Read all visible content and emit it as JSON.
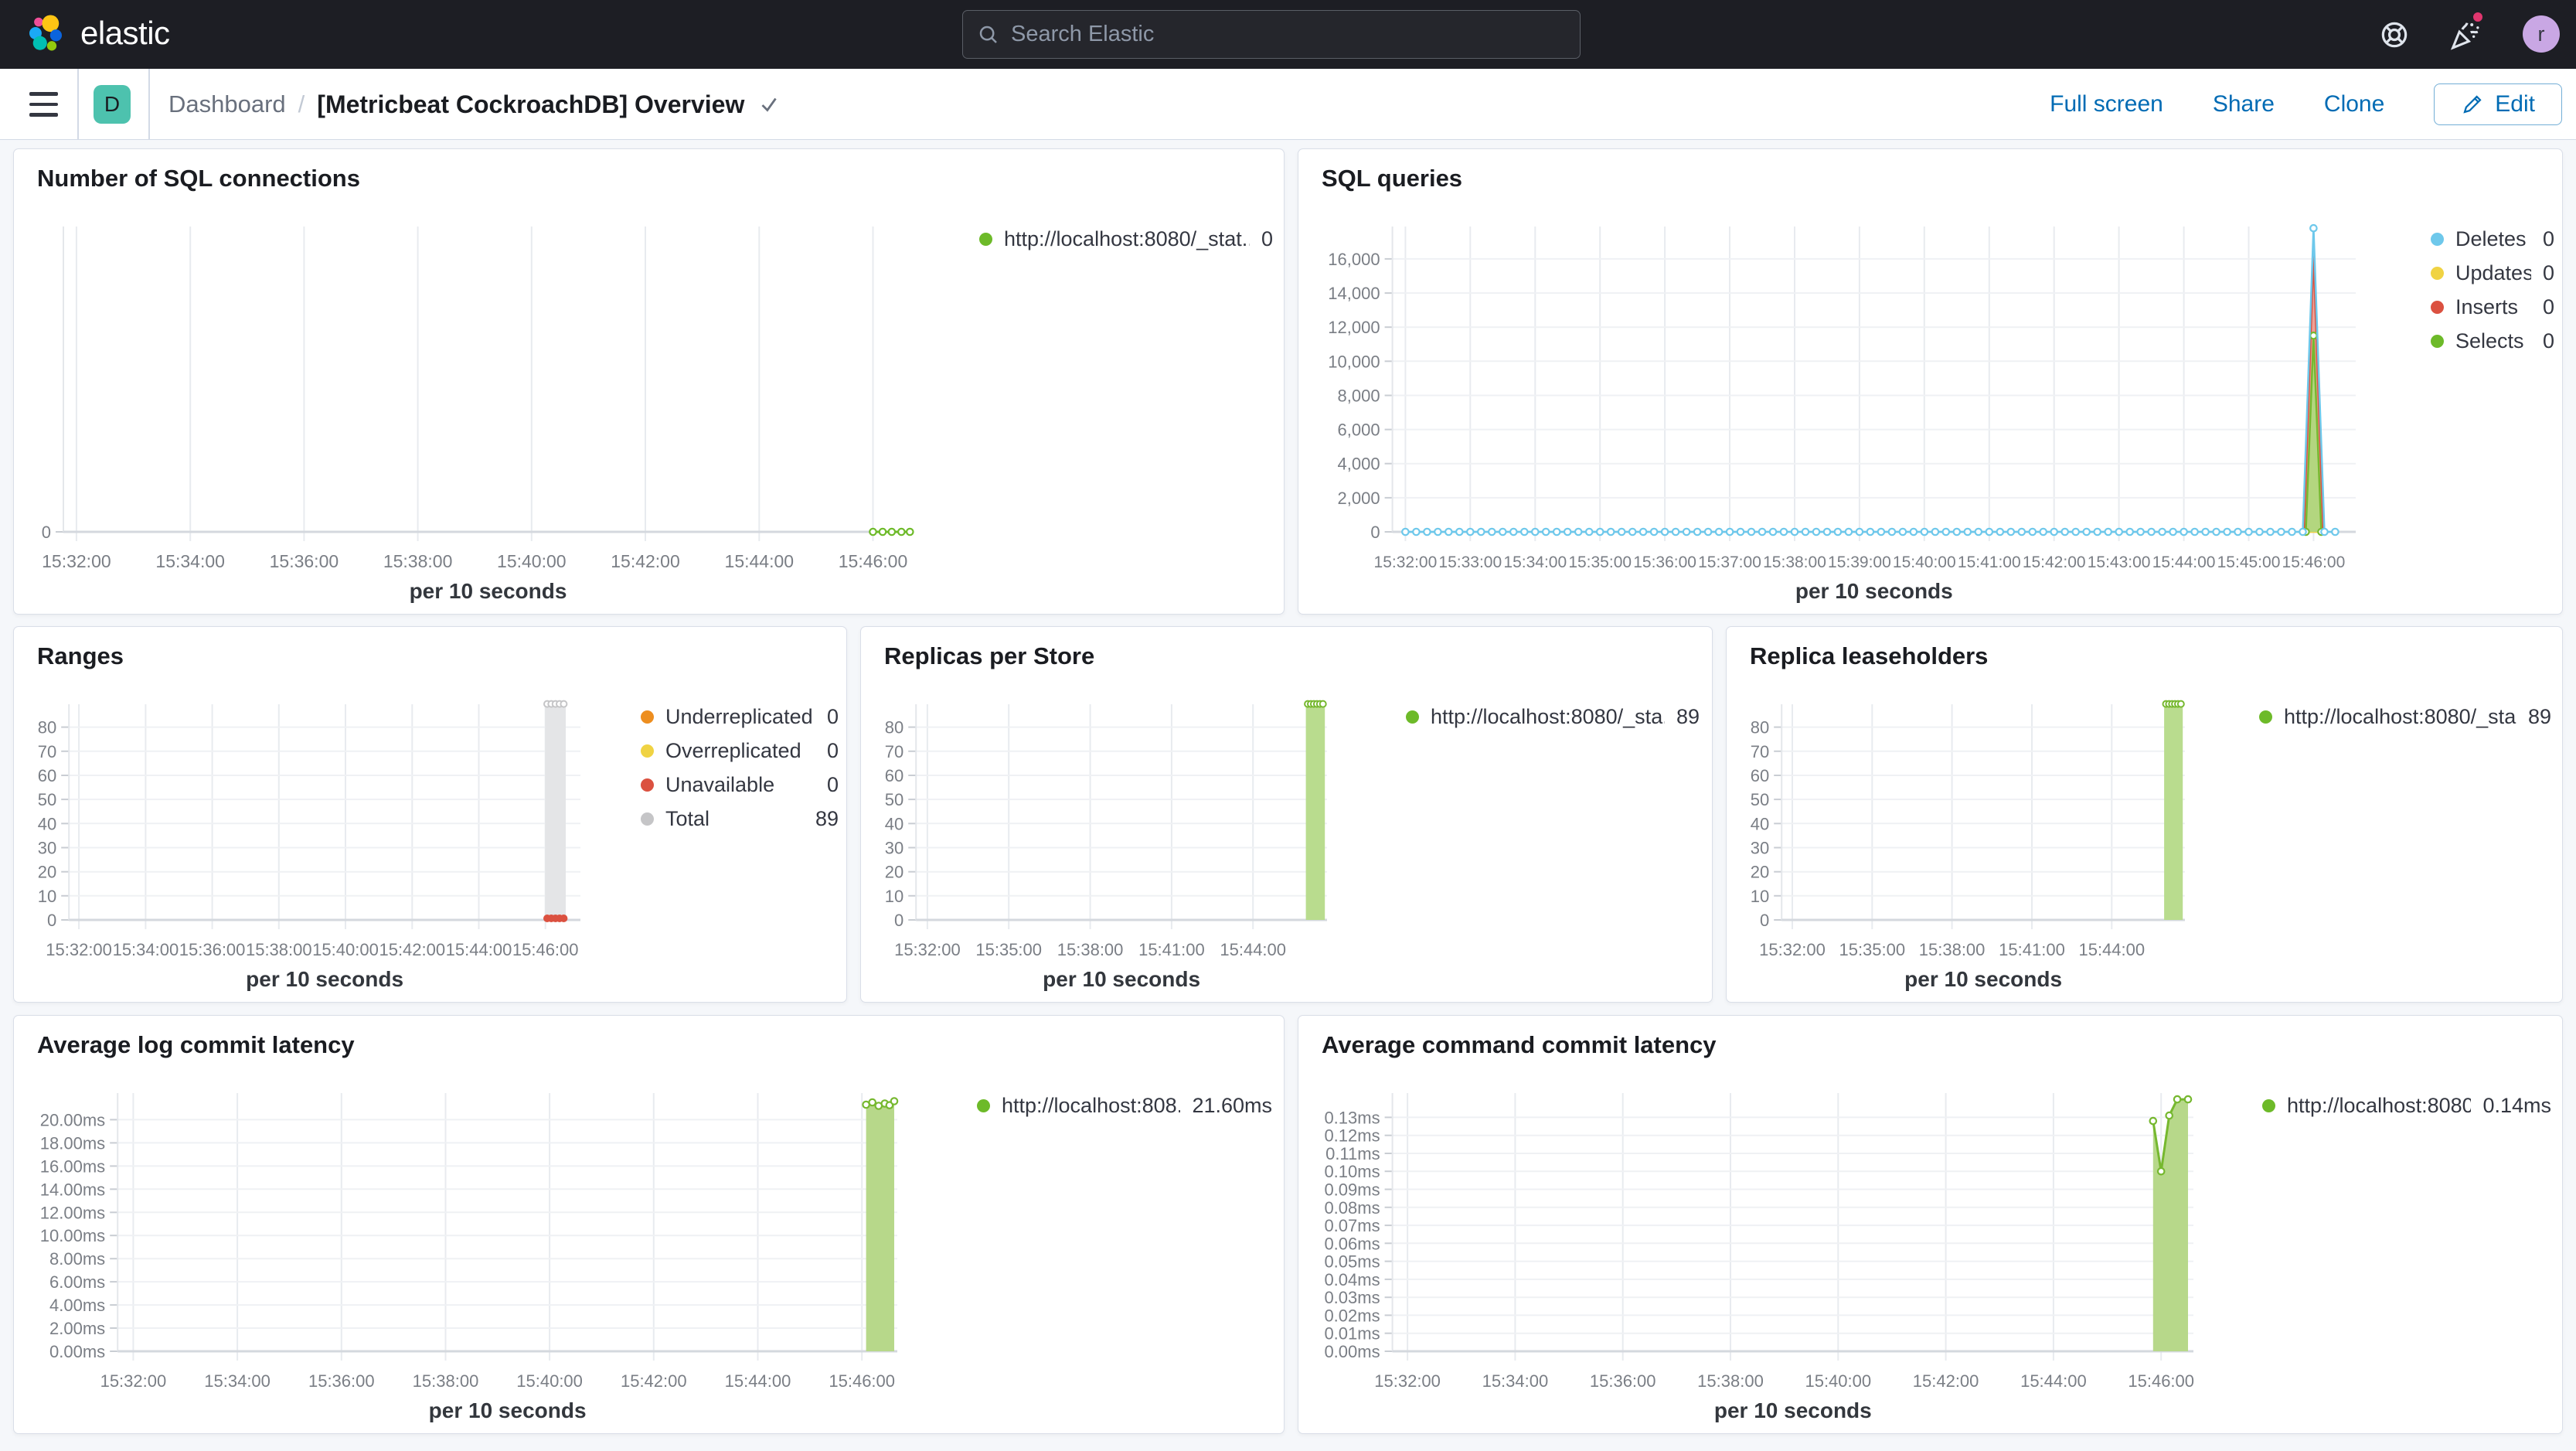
{
  "header": {
    "brand": "elastic",
    "search_placeholder": "Search Elastic",
    "avatar_initial": "r",
    "bg_color": "#1D1E24",
    "notification_dot_color": "#E0366E",
    "avatar_color": "#C9A7E4"
  },
  "nav": {
    "app_badge": "D",
    "app_badge_color": "#4DC2AE",
    "breadcrumb_section": "Dashboard",
    "breadcrumb_sep": "/",
    "title": "[Metricbeat CockroachDB] Overview",
    "full_screen": "Full screen",
    "share": "Share",
    "clone": "Clone",
    "edit": "Edit",
    "link_color": "#006BB4"
  },
  "panels": [
    {
      "title": "Number of SQL connections",
      "legend": {
        "items": [
          {
            "color": "#6DBA29",
            "label": "http://localhost:8080/_stat...",
            "value": "0"
          }
        ]
      },
      "chart": {
        "type": "line",
        "x_domain": [
          31.77,
          46.7
        ],
        "x_ticks": [
          {
            "label": "15:32:00",
            "t": 32
          },
          {
            "label": "15:34:00",
            "t": 34
          },
          {
            "label": "15:36:00",
            "t": 36
          },
          {
            "label": "15:38:00",
            "t": 38
          },
          {
            "label": "15:40:00",
            "t": 40
          },
          {
            "label": "15:42:00",
            "t": 42
          },
          {
            "label": "15:44:00",
            "t": 44
          },
          {
            "label": "15:46:00",
            "t": 46
          }
        ],
        "x_tick_font": 23,
        "y_domain_max": 10,
        "y_ticks": [
          {
            "label": "0",
            "v": 0
          }
        ],
        "axis_label": "per 10 seconds",
        "series": [
          {
            "name": "http://localhost:8080/_stat...",
            "type": "line",
            "color": "#6DBA29",
            "width": 3,
            "marker": true,
            "points": [
              [
                46.0,
                0
              ],
              [
                46.17,
                0
              ],
              [
                46.33,
                0
              ],
              [
                46.5,
                0
              ],
              [
                46.65,
                0
              ]
            ]
          }
        ]
      }
    },
    {
      "title": "SQL queries",
      "legend": {
        "items": [
          {
            "color": "#6EC8EB",
            "label": "Deletes",
            "value": "0"
          },
          {
            "color": "#F0D343",
            "label": "Updates",
            "value": "0"
          },
          {
            "color": "#DB5140",
            "label": "Inserts",
            "value": "0"
          },
          {
            "color": "#6DBA29",
            "label": "Selects",
            "value": "0"
          }
        ]
      },
      "chart": {
        "type": "line",
        "x_domain": [
          31.8,
          46.65
        ],
        "x_ticks": [
          {
            "label": "15:32:00",
            "t": 32
          },
          {
            "label": "15:33:00",
            "t": 33
          },
          {
            "label": "15:34:00",
            "t": 34
          },
          {
            "label": "15:35:00",
            "t": 35
          },
          {
            "label": "15:36:00",
            "t": 36
          },
          {
            "label": "15:37:00",
            "t": 37
          },
          {
            "label": "15:38:00",
            "t": 38
          },
          {
            "label": "15:39:00",
            "t": 39
          },
          {
            "label": "15:40:00",
            "t": 40
          },
          {
            "label": "15:41:00",
            "t": 41
          },
          {
            "label": "15:42:00",
            "t": 42
          },
          {
            "label": "15:43:00",
            "t": 43
          },
          {
            "label": "15:44:00",
            "t": 44
          },
          {
            "label": "15:45:00",
            "t": 45
          },
          {
            "label": "15:46:00",
            "t": 46
          }
        ],
        "x_tick_font": 21,
        "y_domain_max": 17900,
        "y_ticks": [
          {
            "label": "0",
            "v": 0
          },
          {
            "label": "2,000",
            "v": 2000
          },
          {
            "label": "4,000",
            "v": 4000
          },
          {
            "label": "6,000",
            "v": 6000
          },
          {
            "label": "8,000",
            "v": 8000
          },
          {
            "label": "10,000",
            "v": 10000
          },
          {
            "label": "12,000",
            "v": 12000
          },
          {
            "label": "14,000",
            "v": 14000
          },
          {
            "label": "16,000",
            "v": 16000
          }
        ],
        "axis_label": "per 10 seconds",
        "series": [
          {
            "name": "Updates",
            "type": "line",
            "color": "#F0D343",
            "width": 2.5,
            "marker": false,
            "points": [
              [
                45.83,
                0
              ],
              [
                46.17,
                0
              ]
            ]
          },
          {
            "name": "Inserts",
            "type": "area",
            "color": "#DB5140",
            "fill": "#EDA197",
            "width": 2.5,
            "marker": false,
            "points": [
              [
                45.85,
                0
              ],
              [
                46.0,
                16200
              ],
              [
                46.15,
                0
              ]
            ]
          },
          {
            "name": "Selects",
            "type": "area",
            "color": "#76B82F",
            "fill": "#B3D67F",
            "width": 2.5,
            "marker": true,
            "points": [
              [
                45.88,
                0
              ],
              [
                46.0,
                11500
              ],
              [
                46.12,
                0
              ]
            ]
          },
          {
            "name": "Deletes",
            "type": "line",
            "color": "#6EC8EB",
            "width": 2.5,
            "marker": true,
            "zero_range": [
              32.0,
              46.5,
              0.16667
            ],
            "points": [
              [
                46.0,
                17800
              ]
            ]
          }
        ]
      }
    },
    {
      "title": "Ranges",
      "legend": {
        "items": [
          {
            "color": "#ED8E1F",
            "label": "Underreplicated",
            "value": "0"
          },
          {
            "color": "#F0D343",
            "label": "Overreplicated",
            "value": "0"
          },
          {
            "color": "#DB5140",
            "label": "Unavailable",
            "value": "0"
          },
          {
            "color": "#C5C5C7",
            "label": "Total",
            "value": "89"
          }
        ]
      },
      "chart": {
        "type": "bar",
        "x_domain": [
          31.7,
          47.05
        ],
        "x_ticks": [
          {
            "label": "15:32:00",
            "t": 32
          },
          {
            "label": "15:34:00",
            "t": 34
          },
          {
            "label": "15:36:00",
            "t": 36
          },
          {
            "label": "15:38:00",
            "t": 38
          },
          {
            "label": "15:40:00",
            "t": 40
          },
          {
            "label": "15:42:00",
            "t": 42
          },
          {
            "label": "15:44:00",
            "t": 44
          },
          {
            "label": "15:46:00",
            "t": 46
          }
        ],
        "x_tick_font": 22,
        "y_domain_max": 89.5,
        "y_ticks": [
          {
            "label": "0",
            "v": 0
          },
          {
            "label": "10",
            "v": 10
          },
          {
            "label": "20",
            "v": 20
          },
          {
            "label": "30",
            "v": 30
          },
          {
            "label": "40",
            "v": 40
          },
          {
            "label": "50",
            "v": 50
          },
          {
            "label": "60",
            "v": 60
          },
          {
            "label": "70",
            "v": 70
          },
          {
            "label": "80",
            "v": 80
          }
        ],
        "axis_label": "per 10 seconds",
        "series": [
          {
            "name": "Total",
            "type": "bar",
            "t": 46.3,
            "halfwidth": 0.31,
            "value": 89,
            "fill": "#E4E5E7",
            "edge": "#C5C5C7",
            "top_markers": 5,
            "bottom_markers": {
              "color": "#DB5140",
              "count": 5
            }
          }
        ]
      }
    },
    {
      "title": "Replicas per Store",
      "legend": {
        "items": [
          {
            "color": "#6DBA29",
            "label": "http://localhost:8080/_sta...",
            "value": "89"
          }
        ]
      },
      "chart": {
        "type": "bar",
        "x_domain": [
          31.58,
          46.73
        ],
        "x_ticks": [
          {
            "label": "15:32:00",
            "t": 32
          },
          {
            "label": "15:35:00",
            "t": 35
          },
          {
            "label": "15:38:00",
            "t": 38
          },
          {
            "label": "15:41:00",
            "t": 41
          },
          {
            "label": "15:44:00",
            "t": 44
          }
        ],
        "x_tick_font": 22,
        "y_domain_max": 89.5,
        "y_ticks": [
          {
            "label": "0",
            "v": 0
          },
          {
            "label": "10",
            "v": 10
          },
          {
            "label": "20",
            "v": 20
          },
          {
            "label": "30",
            "v": 30
          },
          {
            "label": "40",
            "v": 40
          },
          {
            "label": "50",
            "v": 50
          },
          {
            "label": "60",
            "v": 60
          },
          {
            "label": "70",
            "v": 70
          },
          {
            "label": "80",
            "v": 80
          }
        ],
        "axis_label": "per 10 seconds",
        "series": [
          {
            "name": "http://localhost:8080/_sta...",
            "type": "bar",
            "t": 46.3,
            "halfwidth": 0.35,
            "value": 89,
            "fill": "#B9DC8E",
            "edge": "#76B82F",
            "top_markers": 6
          }
        ]
      }
    },
    {
      "title": "Replica leaseholders",
      "legend": {
        "items": [
          {
            "color": "#6DBA29",
            "label": "http://localhost:8080/_sta...",
            "value": "89"
          }
        ]
      },
      "chart": {
        "type": "bar",
        "x_domain": [
          31.6,
          46.75
        ],
        "x_ticks": [
          {
            "label": "15:32:00",
            "t": 32
          },
          {
            "label": "15:35:00",
            "t": 35
          },
          {
            "label": "15:38:00",
            "t": 38
          },
          {
            "label": "15:41:00",
            "t": 41
          },
          {
            "label": "15:44:00",
            "t": 44
          }
        ],
        "x_tick_font": 22,
        "y_domain_max": 89.5,
        "y_ticks": [
          {
            "label": "0",
            "v": 0
          },
          {
            "label": "10",
            "v": 10
          },
          {
            "label": "20",
            "v": 20
          },
          {
            "label": "30",
            "v": 30
          },
          {
            "label": "40",
            "v": 40
          },
          {
            "label": "50",
            "v": 50
          },
          {
            "label": "60",
            "v": 60
          },
          {
            "label": "70",
            "v": 70
          },
          {
            "label": "80",
            "v": 80
          }
        ],
        "axis_label": "per 10 seconds",
        "series": [
          {
            "name": "http://localhost:8080/_sta...",
            "type": "bar",
            "t": 46.32,
            "halfwidth": 0.35,
            "value": 89,
            "fill": "#B9DC8E",
            "edge": "#76B82F",
            "top_markers": 6
          }
        ]
      }
    },
    {
      "title": "Average log commit latency",
      "legend": {
        "items": [
          {
            "color": "#6DBA29",
            "label": "http://localhost:808...",
            "value": "21.60ms"
          }
        ]
      },
      "chart": {
        "type": "area",
        "x_domain": [
          31.7,
          46.68
        ],
        "x_ticks": [
          {
            "label": "15:32:00",
            "t": 32
          },
          {
            "label": "15:34:00",
            "t": 34
          },
          {
            "label": "15:36:00",
            "t": 36
          },
          {
            "label": "15:38:00",
            "t": 38
          },
          {
            "label": "15:40:00",
            "t": 40
          },
          {
            "label": "15:42:00",
            "t": 42
          },
          {
            "label": "15:44:00",
            "t": 44
          },
          {
            "label": "15:46:00",
            "t": 46
          }
        ],
        "x_tick_font": 22,
        "y_domain_max": 22.3,
        "y_ticks": [
          {
            "label": "0.00ms",
            "v": 0
          },
          {
            "label": "2.00ms",
            "v": 2
          },
          {
            "label": "4.00ms",
            "v": 4
          },
          {
            "label": "6.00ms",
            "v": 6
          },
          {
            "label": "8.00ms",
            "v": 8
          },
          {
            "label": "10.00ms",
            "v": 10
          },
          {
            "label": "12.00ms",
            "v": 12
          },
          {
            "label": "14.00ms",
            "v": 14
          },
          {
            "label": "16.00ms",
            "v": 16
          },
          {
            "label": "18.00ms",
            "v": 18
          },
          {
            "label": "20.00ms",
            "v": 20
          }
        ],
        "axis_label": "per 10 seconds",
        "series": [
          {
            "name": "http://localhost:808...",
            "type": "area",
            "color": "#76B82F",
            "fill": "#B7D88A",
            "width": 3,
            "marker": true,
            "points": [
              [
                46.08,
                21.3
              ],
              [
                46.2,
                21.5
              ],
              [
                46.32,
                21.2
              ],
              [
                46.44,
                21.4
              ],
              [
                46.53,
                21.25
              ],
              [
                46.62,
                21.6
              ]
            ]
          }
        ]
      }
    },
    {
      "title": "Average command commit latency",
      "legend": {
        "items": [
          {
            "color": "#6DBA29",
            "label": "http://localhost:8080...",
            "value": "0.14ms"
          }
        ]
      },
      "chart": {
        "type": "area",
        "x_domain": [
          31.72,
          46.6
        ],
        "x_ticks": [
          {
            "label": "15:32:00",
            "t": 32
          },
          {
            "label": "15:34:00",
            "t": 34
          },
          {
            "label": "15:36:00",
            "t": 36
          },
          {
            "label": "15:38:00",
            "t": 38
          },
          {
            "label": "15:40:00",
            "t": 40
          },
          {
            "label": "15:42:00",
            "t": 42
          },
          {
            "label": "15:44:00",
            "t": 44
          },
          {
            "label": "15:46:00",
            "t": 46
          }
        ],
        "x_tick_font": 22,
        "y_domain_max": 0.1435,
        "y_ticks": [
          {
            "label": "0.00ms",
            "v": 0
          },
          {
            "label": "0.01ms",
            "v": 0.01
          },
          {
            "label": "0.02ms",
            "v": 0.02
          },
          {
            "label": "0.03ms",
            "v": 0.03
          },
          {
            "label": "0.04ms",
            "v": 0.04
          },
          {
            "label": "0.05ms",
            "v": 0.05
          },
          {
            "label": "0.06ms",
            "v": 0.06
          },
          {
            "label": "0.07ms",
            "v": 0.07
          },
          {
            "label": "0.08ms",
            "v": 0.08
          },
          {
            "label": "0.09ms",
            "v": 0.09
          },
          {
            "label": "0.10ms",
            "v": 0.1
          },
          {
            "label": "0.11ms",
            "v": 0.11
          },
          {
            "label": "0.12ms",
            "v": 0.12
          },
          {
            "label": "0.13ms",
            "v": 0.13
          }
        ],
        "axis_label": "per 10 seconds",
        "series": [
          {
            "name": "http://localhost:8080...",
            "type": "area",
            "color": "#76B82F",
            "fill": "#B7D88A",
            "width": 3,
            "marker": true,
            "points": [
              [
                45.85,
                0.128
              ],
              [
                46.0,
                0.1
              ],
              [
                46.15,
                0.131
              ],
              [
                46.3,
                0.14
              ],
              [
                46.5,
                0.14
              ]
            ]
          }
        ]
      }
    }
  ]
}
